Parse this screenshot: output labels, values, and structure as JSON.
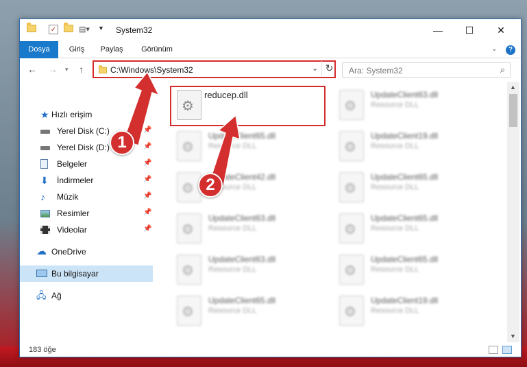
{
  "window": {
    "title": "System32",
    "controls": {
      "minimize": "—",
      "maximize": "☐",
      "close": "✕"
    }
  },
  "ribbon": {
    "tabs": [
      {
        "label": "Dosya",
        "active": true
      },
      {
        "label": "Giriş"
      },
      {
        "label": "Paylaş"
      },
      {
        "label": "Görünüm"
      }
    ],
    "help": "?"
  },
  "address": {
    "path": "C:\\Windows\\System32",
    "search_placeholder": "Ara: System32"
  },
  "sidebar": {
    "items": [
      {
        "label": "Hızlı erişim",
        "icon": "star-icon"
      },
      {
        "label": "Yerel Disk (C:)",
        "icon": "drive-icon",
        "pinned": true
      },
      {
        "label": "Yerel Disk (D:)",
        "icon": "drive-icon",
        "pinned": true
      },
      {
        "label": "Belgeler",
        "icon": "documents-icon",
        "pinned": true
      },
      {
        "label": "İndirmeler",
        "icon": "download-icon",
        "pinned": true
      },
      {
        "label": "Müzik",
        "icon": "music-icon",
        "pinned": true
      },
      {
        "label": "Resimler",
        "icon": "pictures-icon",
        "pinned": true
      },
      {
        "label": "Videolar",
        "icon": "videos-icon",
        "pinned": true
      },
      {
        "label": "OneDrive",
        "icon": "cloud-icon"
      },
      {
        "label": "Bu bilgisayar",
        "icon": "computer-icon",
        "selected": true
      },
      {
        "label": "Ağ",
        "icon": "network-icon"
      }
    ]
  },
  "files": [
    {
      "name": "reducep.dll",
      "type": ""
    },
    {
      "name": "UpdateClient63.dll",
      "type": "Resource DLL"
    },
    {
      "name": "UpdateClient65.dll",
      "type": "Resource DLL"
    },
    {
      "name": "UpdateClient19.dll",
      "type": "Resource DLL"
    },
    {
      "name": "UpdateClient42.dll",
      "type": "Resource DLL"
    },
    {
      "name": "UpdateClient65.dll",
      "type": "Resource DLL"
    },
    {
      "name": "UpdateClient63.dll",
      "type": "Resource DLL"
    },
    {
      "name": "UpdateClient65.dll",
      "type": "Resource DLL"
    },
    {
      "name": "UpdateClient63.dll",
      "type": "Resource DLL"
    },
    {
      "name": "UpdateClient65.dll",
      "type": "Resource DLL"
    },
    {
      "name": "UpdateClient65.dll",
      "type": "Resource DLL"
    },
    {
      "name": "UpdateClient19.dll",
      "type": "Resource DLL"
    }
  ],
  "status": {
    "count": "183 öğe"
  },
  "callouts": {
    "one": "1",
    "two": "2"
  },
  "colors": {
    "accent": "#1979ca",
    "highlight": "#d52b2b",
    "selection": "#cce4f7"
  }
}
